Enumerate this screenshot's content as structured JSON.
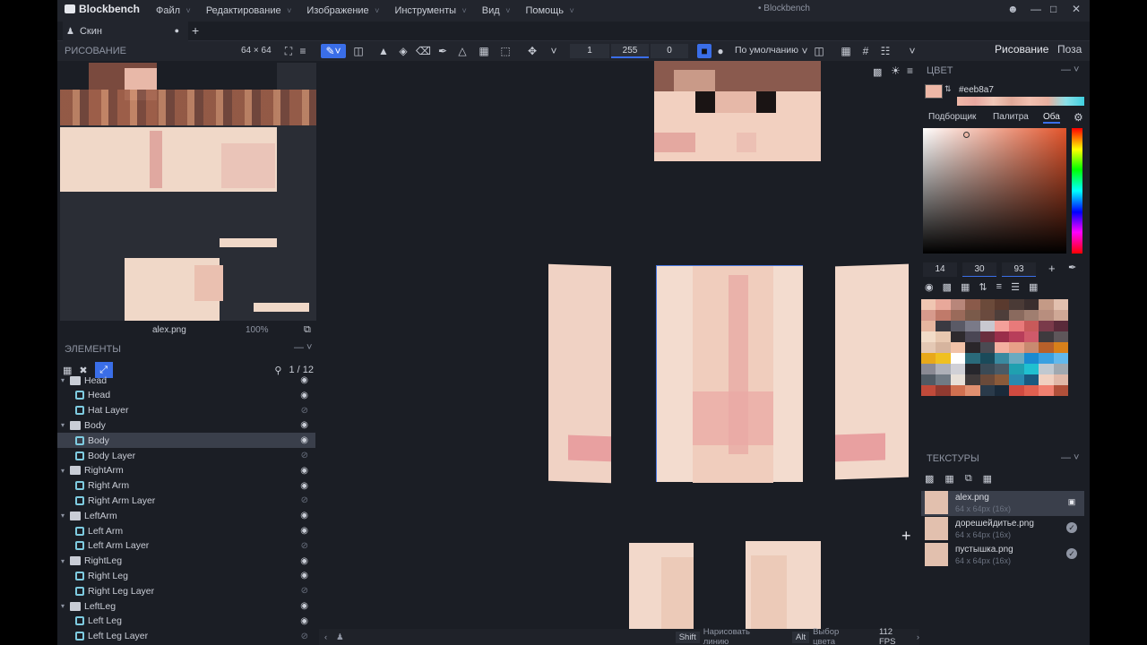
{
  "app": {
    "name": "Blockbench",
    "window_title": "• Blockbench",
    "menu": [
      "Файл",
      "Редактирование",
      "Изображение",
      "Инструменты",
      "Вид",
      "Помощь"
    ]
  },
  "tab": {
    "label": "Скин"
  },
  "toolbar": {
    "size": "64 × 64",
    "brush_size": "1",
    "opacity": "255",
    "softness": "0",
    "blend_mode": "По умолчанию",
    "mode_paint": "Рисование",
    "mode_pose": "Поза"
  },
  "left": {
    "paint_header": "РИСОВАНИЕ",
    "uv_filename": "alex.png",
    "uv_zoom": "100%",
    "elements_header": "ЭЛЕМЕНТЫ",
    "elements_count": "1 / 12",
    "outliner": [
      {
        "label": "Head",
        "type": "group",
        "indent": 0,
        "visible": true
      },
      {
        "label": "Head",
        "type": "cube",
        "indent": 1,
        "visible": true
      },
      {
        "label": "Hat Layer",
        "type": "cube",
        "indent": 1,
        "visible": false
      },
      {
        "label": "Body",
        "type": "group",
        "indent": 0,
        "visible": true
      },
      {
        "label": "Body",
        "type": "cube",
        "indent": 1,
        "visible": true,
        "selected": true
      },
      {
        "label": "Body Layer",
        "type": "cube",
        "indent": 1,
        "visible": false
      },
      {
        "label": "RightArm",
        "type": "group",
        "indent": 0,
        "visible": true
      },
      {
        "label": "Right Arm",
        "type": "cube",
        "indent": 1,
        "visible": true
      },
      {
        "label": "Right Arm Layer",
        "type": "cube",
        "indent": 1,
        "visible": false
      },
      {
        "label": "LeftArm",
        "type": "group",
        "indent": 0,
        "visible": true
      },
      {
        "label": "Left Arm",
        "type": "cube",
        "indent": 1,
        "visible": true
      },
      {
        "label": "Left Arm Layer",
        "type": "cube",
        "indent": 1,
        "visible": false
      },
      {
        "label": "RightLeg",
        "type": "group",
        "indent": 0,
        "visible": true
      },
      {
        "label": "Right Leg",
        "type": "cube",
        "indent": 1,
        "visible": true
      },
      {
        "label": "Right Leg Layer",
        "type": "cube",
        "indent": 1,
        "visible": false
      },
      {
        "label": "LeftLeg",
        "type": "group",
        "indent": 0,
        "visible": true
      },
      {
        "label": "Left Leg",
        "type": "cube",
        "indent": 1,
        "visible": true
      },
      {
        "label": "Left Leg Layer",
        "type": "cube",
        "indent": 1,
        "visible": false
      }
    ]
  },
  "status": {
    "shift_key": "Shift",
    "shift_hint": "Нарисовать линию",
    "alt_key": "Alt",
    "alt_hint": "Выбор цвета",
    "fps": "112 FPS"
  },
  "color": {
    "header": "ЦВЕТ",
    "hex": "#eeb8a7",
    "current": "#eeb8a7",
    "tabs": [
      "Подборщик",
      "Палитра",
      "Оба"
    ],
    "active_tab": "Оба",
    "h": "14",
    "s": "30",
    "v": "93",
    "palette": [
      "#f0c6b2",
      "#e8a89a",
      "#b8867a",
      "#8a5a4a",
      "#6b4a3a",
      "#5a3a2e",
      "#4a3a36",
      "#3a2e2e",
      "#c49a86",
      "#e2c0ae",
      "#d79a8c",
      "#c07a6a",
      "#9a6a5a",
      "#7a5a4a",
      "#6a4a3e",
      "#4e3e3a",
      "#8a6a5e",
      "#a07e70",
      "#b88e7e",
      "#cfa896",
      "#e6b6a0",
      "#3a3a42",
      "#5a5a66",
      "#7a7a88",
      "#c8c8d0",
      "#f4a09a",
      "#e87a7a",
      "#c85a5a",
      "#7a3a4a",
      "#5a2a3a",
      "#f2dcc8",
      "#e8c8b0",
      "#2e2a2e",
      "#4a4654",
      "#6a2e3e",
      "#9a2e4a",
      "#b83e5a",
      "#d05a6a",
      "#3e3a3e",
      "#5e565a",
      "#e4c8b4",
      "#d6b49e",
      "#f2c2a8",
      "#2a262a",
      "#4a4a52",
      "#f4b0a0",
      "#e8a088",
      "#c88a70",
      "#b8602a",
      "#d8801a",
      "#e8a81a",
      "#f0c020",
      "#ffffff",
      "#2a6a7a",
      "#1a4a5a",
      "#3a8aa0",
      "#6aaac0",
      "#1a8ad0",
      "#3aa0e0",
      "#62b8ec",
      "#8a8a94",
      "#aeb0b8",
      "#d0d0d6",
      "#26262c",
      "#3a4a56",
      "#4a5a66",
      "#20a0b0",
      "#20c0d0",
      "#c0c8d0",
      "#a0a8b0",
      "#505a64",
      "#707a84",
      "#e8e0d8",
      "#403a3a",
      "#6a4a3a",
      "#8a5a3a",
      "#2a8ab0",
      "#1a5a80",
      "#f0d0c0",
      "#e0b8a8",
      "#c04a3a",
      "#903a30",
      "#d07050",
      "#e09070",
      "#2a3a4a",
      "#1a2a3a",
      "#d04a40",
      "#e06050",
      "#f08070",
      "#b0503a"
    ]
  },
  "textures": {
    "header": "ТЕКСТУРЫ",
    "items": [
      {
        "name": "alex.png",
        "size": "64 x 64px (16x)",
        "selected": true,
        "icon": "save-icon"
      },
      {
        "name": "дорешейдитье.png",
        "size": "64 x 64px (16x)",
        "selected": false,
        "icon": "check-icon"
      },
      {
        "name": "пустышка.png",
        "size": "64 x 64px (16x)",
        "selected": false,
        "icon": "check-icon"
      }
    ]
  }
}
